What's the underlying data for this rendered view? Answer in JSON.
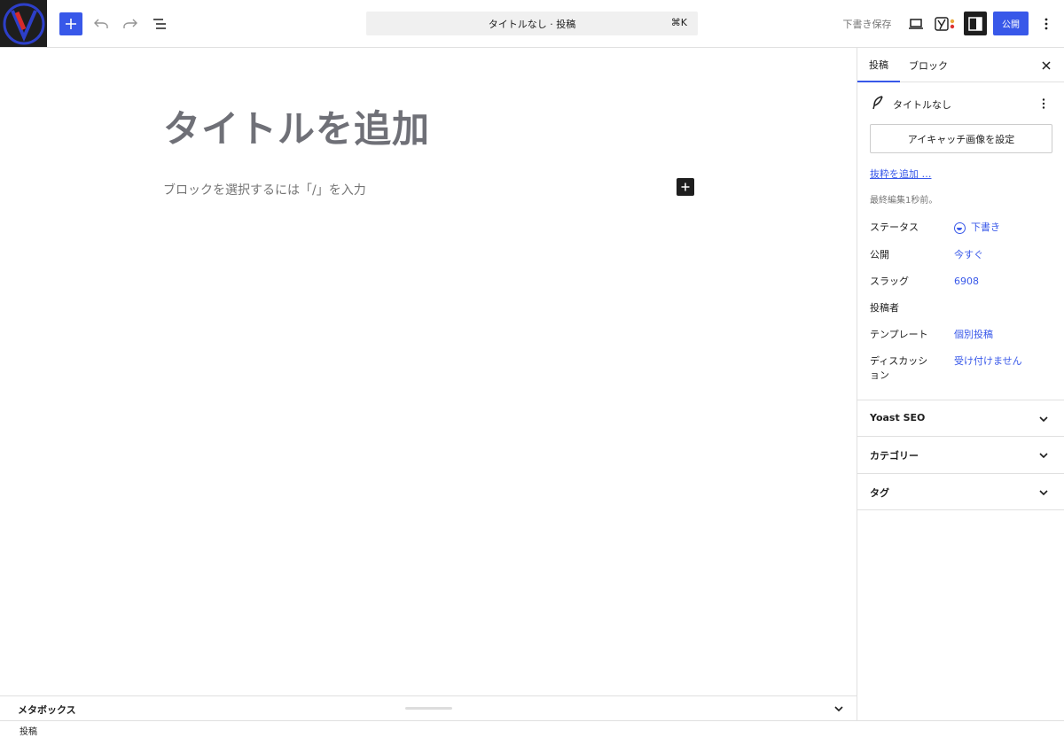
{
  "header": {
    "command_title": "タイトルなし · 投稿",
    "command_shortcut": "⌘K",
    "save_draft_label": "下書き保存",
    "publish_label": "公開",
    "accent_color": "#3858e9"
  },
  "editor": {
    "title_placeholder": "タイトルを追加",
    "block_placeholder": "ブロックを選択するには「/」を入力"
  },
  "metabox": {
    "label": "メタボックス"
  },
  "footer": {
    "breadcrumb": "投稿"
  },
  "sidebar": {
    "tabs": [
      {
        "label": "投稿",
        "active": true
      },
      {
        "label": "ブロック",
        "active": false
      }
    ],
    "post_title": "タイトルなし",
    "featured_image_label": "アイキャッチ画像を設定",
    "excerpt_link": "抜粋を追加 …",
    "last_edited": "最終編集1秒前。",
    "properties": [
      {
        "label": "ステータス",
        "value": "下書き"
      },
      {
        "label": "公開",
        "value": "今すぐ"
      },
      {
        "label": "スラッグ",
        "value": "6908"
      },
      {
        "label": "投稿者",
        "value": ""
      },
      {
        "label": "テンプレート",
        "value": "個別投稿"
      },
      {
        "label": "ディスカッション",
        "value": "受け付けません"
      }
    ],
    "panels": [
      {
        "title": "Yoast SEO"
      },
      {
        "title": "カテゴリー"
      },
      {
        "title": "タグ"
      }
    ]
  }
}
